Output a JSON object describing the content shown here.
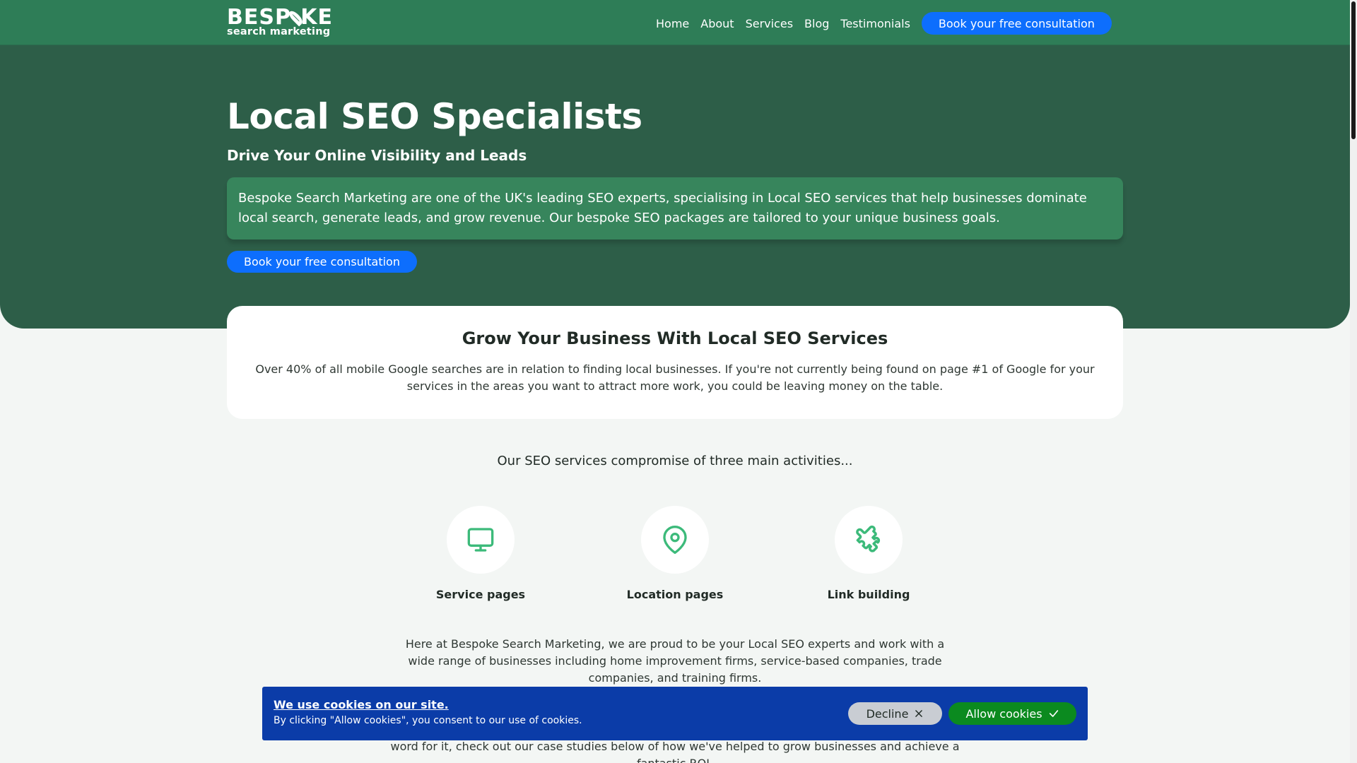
{
  "header": {
    "logo_word_a": "BESP",
    "logo_word_b": "KE",
    "logo_tag": "search marketing",
    "nav": [
      "Home",
      "About",
      "Services",
      "Blog",
      "Testimonials"
    ],
    "cta": "Book your free consultation"
  },
  "hero": {
    "title": "Local SEO Specialists",
    "subtitle": "Drive Your Online Visibility and Leads",
    "body": "Bespoke Search Marketing are one of the UK's leading SEO experts, specialising in Local SEO services that help businesses dominate local search, generate leads, and grow revenue. Our bespoke SEO packages are tailored to your unique business goals.",
    "cta": "Book your free consultation"
  },
  "grow": {
    "title": "Grow Your Business With Local SEO Services",
    "body": "Over 40% of all mobile Google searches are in relation to finding local businesses. If you're not currently being found on page #1 of Google for your services in the areas you want to attract more work, you could be leaving money on the table."
  },
  "intro": "Our SEO services compromise of three main activities...",
  "features": [
    {
      "label": "Service pages",
      "icon": "monitor-icon"
    },
    {
      "label": "Location pages",
      "icon": "map-pin-icon"
    },
    {
      "label": "Link building",
      "icon": "puzzle-icon"
    }
  ],
  "body_copy": "Here at Bespoke Search Marketing, we are proud to be your Local SEO experts and work with a wide range of businesses including home improvement firms, service-based companies, trade companies, and training firms.",
  "body_copy2": "word for it, check out our case studies below of how we've helped to grow businesses and achieve a fantastic ROI.",
  "cookie": {
    "title": "We use cookies on our site.",
    "text": "By clicking \"Allow cookies\", you consent to our use of cookies.",
    "decline": "Decline",
    "allow": "Allow cookies"
  },
  "colors": {
    "header": "#2e7d57",
    "hero": "#2d5e48",
    "accent_button": "#0d6efd",
    "icon_green": "#3cba7a",
    "cookie_bg": "#0b3ca8",
    "allow_green": "#0b8a1f"
  }
}
